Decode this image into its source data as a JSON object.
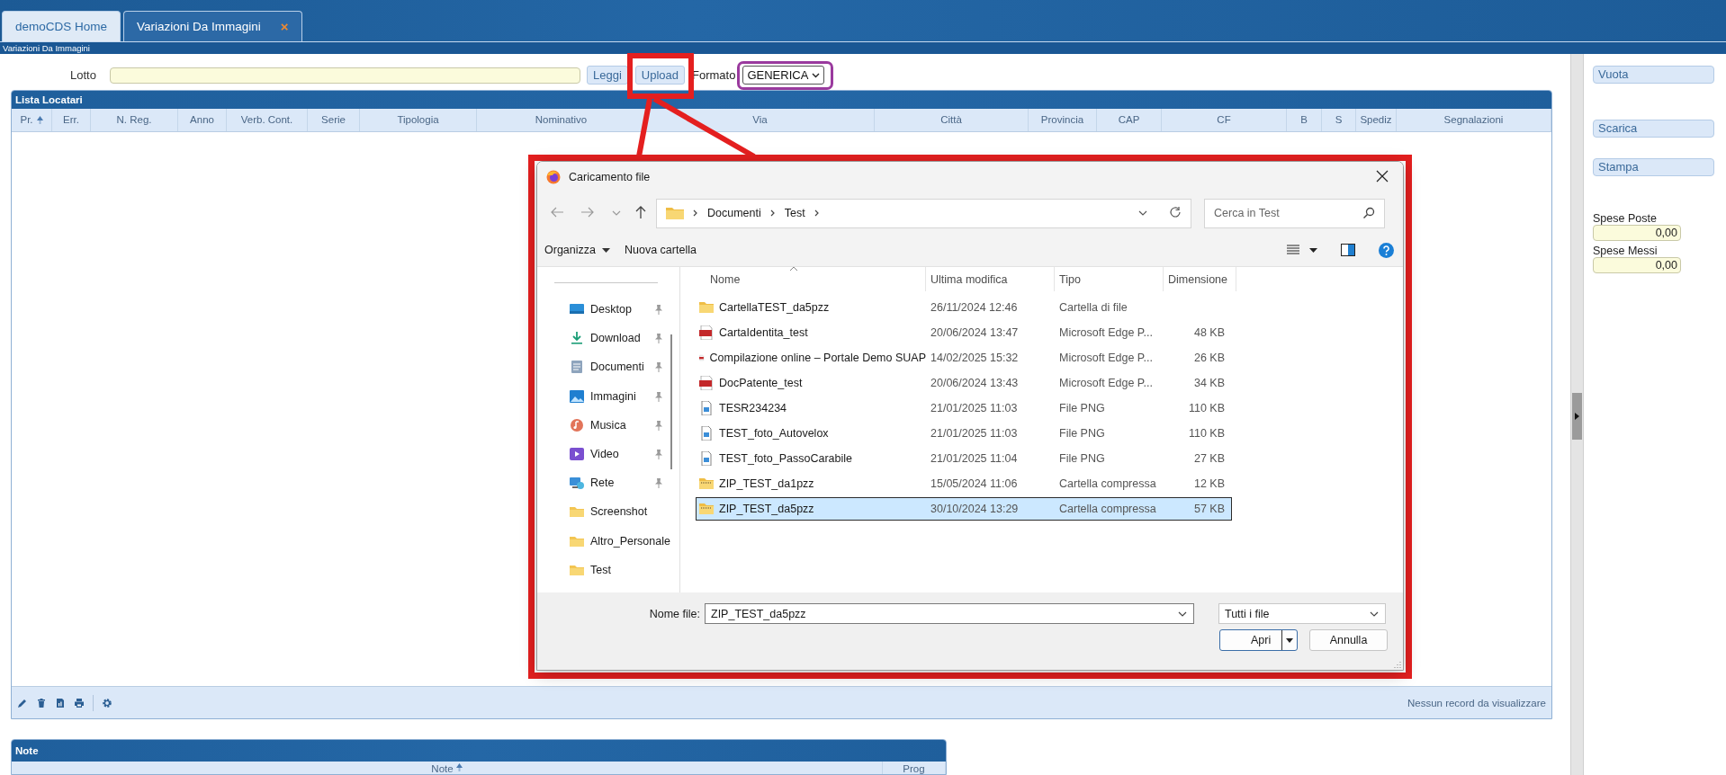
{
  "tabs": [
    {
      "label": "demoCDS Home",
      "selected": false
    },
    {
      "label": "Variazioni Da Immagini",
      "selected": true,
      "close": "×"
    }
  ],
  "page_title": "Variazioni Da Immagini",
  "filter_bar": {
    "label": "Lotto",
    "controls": [
      {
        "kind": "button",
        "label": "Leggi"
      },
      {
        "kind": "button",
        "label": "Upload",
        "color": "#e41f1f"
      },
      {
        "kind": "label",
        "label": "Formato"
      },
      {
        "kind": "select",
        "value": "GENERICA",
        "color": "#9a3a9e"
      }
    ]
  },
  "list_panel": {
    "title": "Lista Locatari",
    "columns": [
      {
        "label": "Pr.",
        "sorted": true
      },
      {
        "label": "Err.",
        "sorted": false
      },
      {
        "label": "N. Reg.",
        "sorted": false
      },
      {
        "label": "Anno",
        "sorted": false
      },
      {
        "label": "Verb. Cont.",
        "sorted": false
      },
      {
        "label": "Serie",
        "sorted": false
      },
      {
        "label": "Tipologia",
        "sorted": false
      },
      {
        "label": "Nominativo",
        "sorted": false
      },
      {
        "label": "Via",
        "sorted": false
      },
      {
        "label": "Città",
        "sorted": false
      },
      {
        "label": "Provincia",
        "sorted": false
      },
      {
        "label": "CAP",
        "sorted": false
      },
      {
        "label": "CF",
        "sorted": false
      },
      {
        "label": "B",
        "sorted": false
      },
      {
        "label": "S",
        "sorted": false
      },
      {
        "label": "Spediz",
        "sorted": false
      },
      {
        "label": "Segnalazioni",
        "sorted": false
      }
    ],
    "status": "Nessun record da visualizzare"
  },
  "note_panel": {
    "title": "Note",
    "columns": [
      {
        "label": "Note",
        "sorted": true
      },
      {
        "label": "Prog",
        "sorted": false
      }
    ]
  },
  "side_panel": {
    "buttons": [
      {
        "label": "Vuota"
      },
      {
        "label": "Scarica"
      },
      {
        "label": "Stampa"
      }
    ],
    "fields": [
      {
        "label": "Spese Poste",
        "value": "0,00"
      },
      {
        "label": "Spese Messi",
        "value": "0,00"
      }
    ]
  },
  "dialog": {
    "title": "Caricamento file",
    "path": [
      "Documenti",
      "Test"
    ],
    "search_placeholder": "Cerca in Test",
    "commands": [
      {
        "label": "Organizza",
        "menu": true
      },
      {
        "label": "Nuova cartella",
        "menu": false
      }
    ],
    "places": [
      {
        "label": "Desktop",
        "kind": "desktop",
        "pinned": true
      },
      {
        "label": "Download",
        "kind": "download",
        "pinned": true
      },
      {
        "label": "Documenti",
        "kind": "documents",
        "pinned": true
      },
      {
        "label": "Immagini",
        "kind": "pictures",
        "pinned": true
      },
      {
        "label": "Musica",
        "kind": "music",
        "pinned": true
      },
      {
        "label": "Video",
        "kind": "video",
        "pinned": true
      },
      {
        "label": "Rete",
        "kind": "network",
        "pinned": true
      },
      {
        "label": "Screenshot",
        "kind": "folder",
        "pinned": false
      },
      {
        "label": "Altro_Personale",
        "kind": "folder",
        "pinned": false
      },
      {
        "label": "Test",
        "kind": "folder",
        "pinned": false
      }
    ],
    "columns": [
      "Nome",
      "Ultima modifica",
      "Tipo",
      "Dimensione"
    ],
    "files": [
      {
        "name": "CartellaTEST_da5pzz",
        "modified": "26/11/2024 12:46",
        "type": "Cartella di file",
        "kind": "folder",
        "selected": false
      },
      {
        "name": "CartaIdentita_test",
        "modified": "20/06/2024 13:47",
        "type": "Microsoft Edge P...",
        "size": "48 KB",
        "kind": "pdf",
        "selected": false
      },
      {
        "name": "Compilazione online – Portale Demo SUAP",
        "modified": "14/02/2025 15:32",
        "type": "Microsoft Edge P...",
        "size": "26 KB",
        "kind": "pdf",
        "selected": false
      },
      {
        "name": "DocPatente_test",
        "modified": "20/06/2024 13:43",
        "type": "Microsoft Edge P...",
        "size": "34 KB",
        "kind": "pdf",
        "selected": false
      },
      {
        "name": "TESR234234",
        "modified": "21/01/2025 11:03",
        "type": "File PNG",
        "size": "110 KB",
        "kind": "png",
        "selected": false
      },
      {
        "name": "TEST_foto_Autovelox",
        "modified": "21/01/2025 11:03",
        "type": "File PNG",
        "size": "110 KB",
        "kind": "png",
        "selected": false
      },
      {
        "name": "TEST_foto_PassoCarabile",
        "modified": "21/01/2025 11:04",
        "type": "File PNG",
        "size": "27 KB",
        "kind": "png",
        "selected": false
      },
      {
        "name": "ZIP_TEST_da1pzz",
        "modified": "15/05/2024 11:06",
        "type": "Cartella compressa",
        "size": "12 KB",
        "kind": "zip",
        "selected": false
      },
      {
        "name": "ZIP_TEST_da5pzz",
        "modified": "30/10/2024 13:29",
        "type": "Cartella compressa",
        "size": "57 KB",
        "kind": "zip",
        "selected": true
      }
    ],
    "filename_label": "Nome file:",
    "filename": "ZIP_TEST_da5pzz",
    "filetype": "Tutti i file",
    "buttons": [
      {
        "label": "Apri",
        "default": true
      },
      {
        "label": "Annulla",
        "default": false
      }
    ]
  }
}
